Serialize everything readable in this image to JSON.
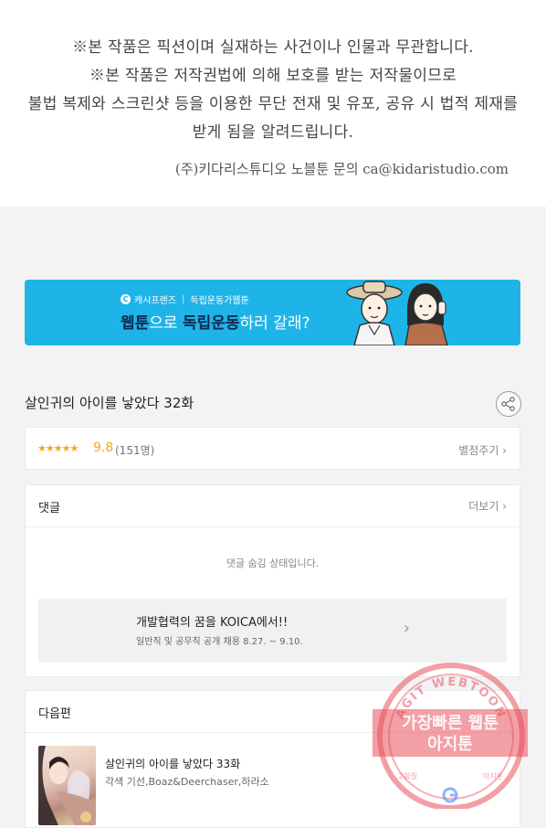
{
  "notice": {
    "line1": "※본 작품은 픽션이며 실재하는 사건이나 인물과 무관합니다.",
    "line2": "※본 작품은 저작권법에 의해 보호를 받는 저작물이므로",
    "line3": "불법 복제와 스크린샷 등을 이용한 무단 전재 및 유포, 공유 시 법적 제재를",
    "line4": "받게 됨을 알려드립니다.",
    "contact": "(주)키다리스튜디오 노블툰 문의 ca@kidaristudio.com"
  },
  "banner": {
    "brand": "캐시프렌즈",
    "campaign": "독립운동가웹툰",
    "headline_pre": "웹툰",
    "headline_mid": "으로 ",
    "headline_bold": "독립운동",
    "headline_post": "하러 갈래?"
  },
  "episode": {
    "title": "살인귀의 아이를 낳았다 32화"
  },
  "rating": {
    "stars": "★★★★★",
    "score": "9.8",
    "count": "(151명)",
    "rate_label": "별점주기 ›"
  },
  "comments": {
    "heading": "댓글",
    "more": "더보기 ›",
    "hidden_message": "댓글 숨김 상태입니다."
  },
  "ad": {
    "title": "개발협력의 꿈을 KOICA에서!!",
    "subtitle": "일반직 및 공무직 공개 채용 8.27. ~ 9.10.",
    "arrow": "›"
  },
  "next": {
    "heading": "다음편",
    "title": "살인귀의 아이를 낳았다 33화",
    "credit": "각색 기선,Boaz&Deerchaser,하라소"
  },
  "stamp": {
    "arc_text": "AGIT WEBTOON",
    "line1": "가장빠른 웹툰",
    "line2": "아지툰",
    "bottom_left": "고화질",
    "bottom_right": "아지툰",
    "color": "#e8505b"
  }
}
